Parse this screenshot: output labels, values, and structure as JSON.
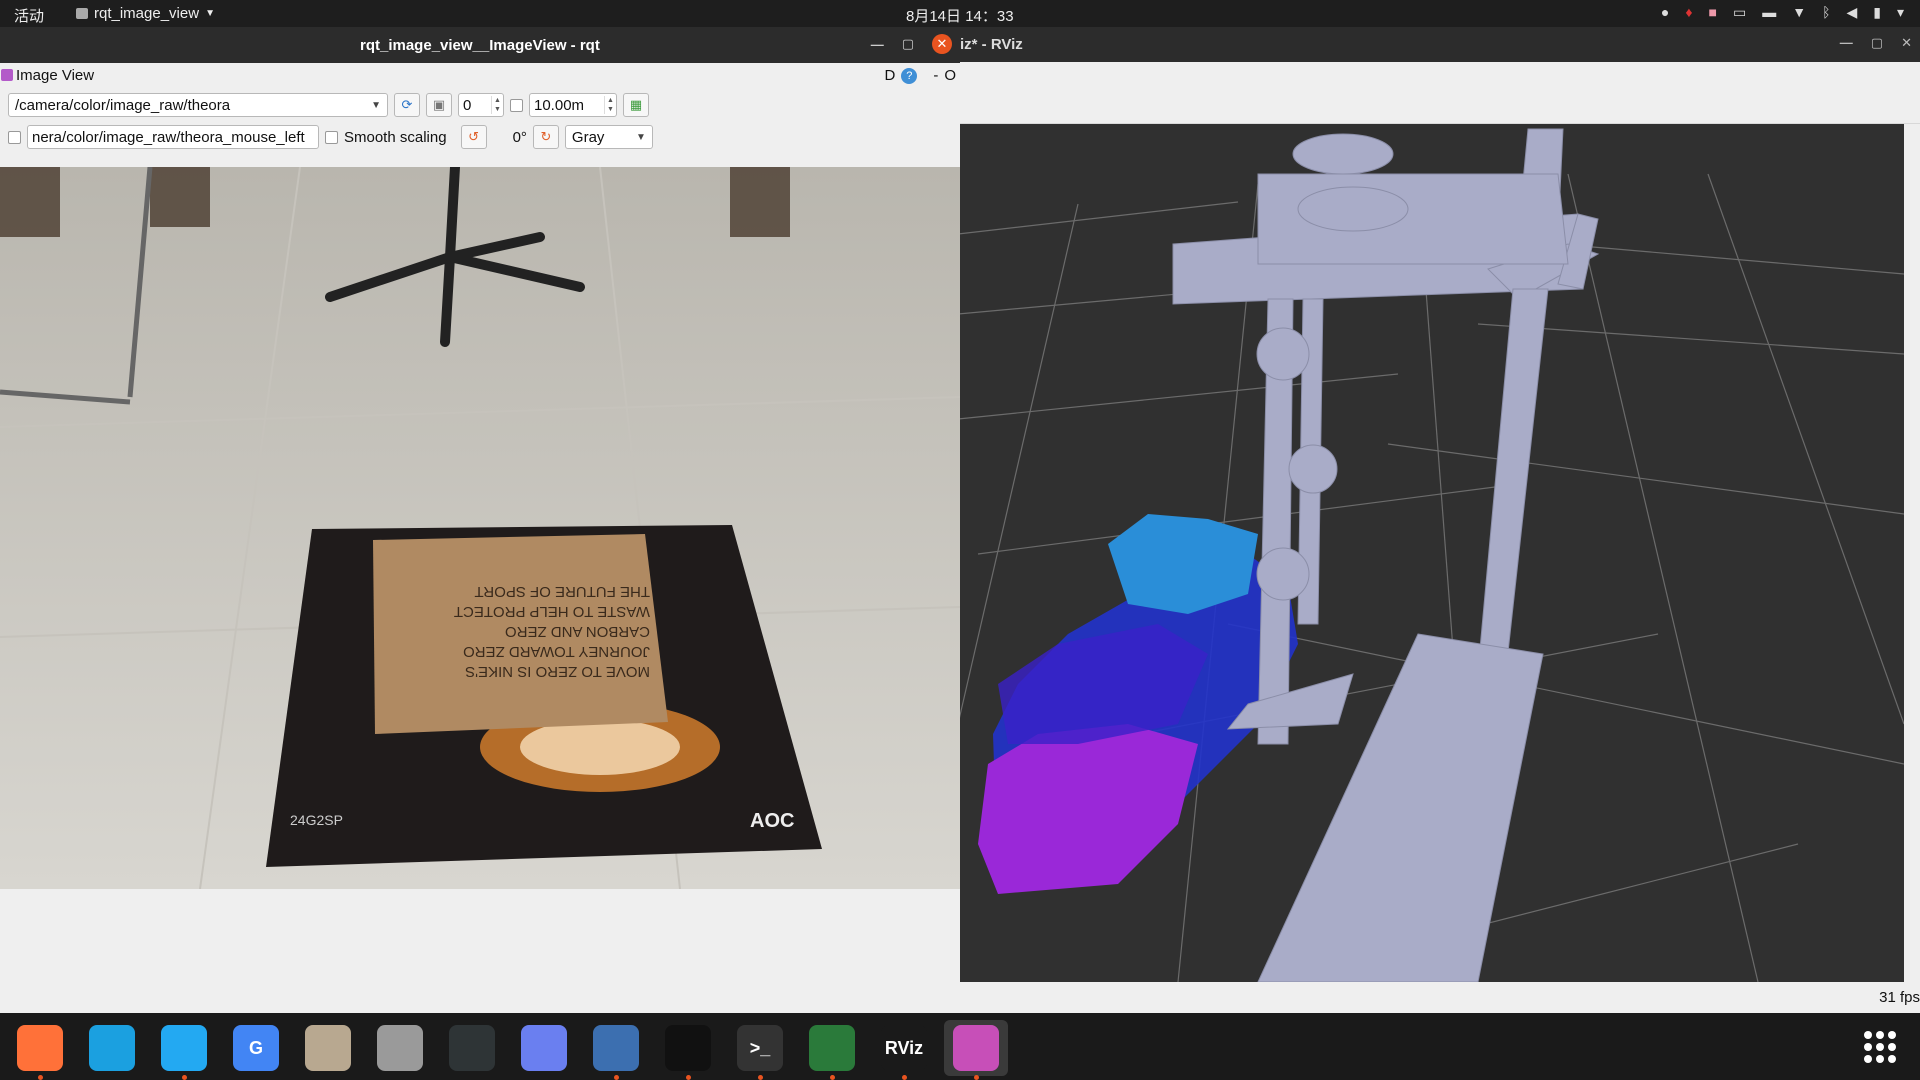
{
  "topbar": {
    "activities": "活动",
    "app_menu": "rqt_image_view",
    "clock": "8月14日  14：33"
  },
  "rviz": {
    "title": "iz* - RViz",
    "fps": "31 fps"
  },
  "rqt": {
    "title": "rqt_image_view__ImageView - rqt",
    "dock_title": "Image View",
    "dock_buttons": {
      "d": "D",
      "help": "?",
      "minus": "-",
      "o": "O"
    },
    "topic": "/camera/color/image_raw/theora",
    "spin_value": "0",
    "max_range": "10.00m",
    "mouse_topic": "nera/color/image_raw/theora_mouse_left",
    "smooth_scaling": "Smooth scaling",
    "rotation": "0°",
    "color_scheme": "Gray",
    "box_text": [
      "MOVE TO ZERO IS NIKE'S",
      "JOURNEY TOWARD ZERO",
      "CARBON AND ZERO",
      "WASTE TO HELP PROTECT",
      "THE FUTURE OF SPORT"
    ],
    "monitor_model": "24G2SP",
    "monitor_brand": "AOC"
  },
  "dock": {
    "apps": [
      {
        "name": "firefox",
        "label": "",
        "color": "#ff7139"
      },
      {
        "name": "edge",
        "label": "",
        "color": "#1ba0e0"
      },
      {
        "name": "vscode",
        "label": "",
        "color": "#23a9f2"
      },
      {
        "name": "translate",
        "label": "G",
        "color": "#4285f4"
      },
      {
        "name": "files",
        "label": "",
        "color": "#b8a890"
      },
      {
        "name": "settings",
        "label": "",
        "color": "#9a9a9a"
      },
      {
        "name": "system-monitor",
        "label": "",
        "color": "#2e3436"
      },
      {
        "name": "screenshot",
        "label": "",
        "color": "#6a7ff0"
      },
      {
        "name": "clash",
        "label": "",
        "color": "#3c6fb0"
      },
      {
        "name": "qq",
        "label": "",
        "color": "#111111"
      },
      {
        "name": "terminal",
        "label": ">_",
        "color": "#333333"
      },
      {
        "name": "camera",
        "label": "",
        "color": "#2a7a3a"
      },
      {
        "name": "rviz",
        "label": "RViz",
        "color": "#1a1a1a"
      },
      {
        "name": "image-viewer",
        "label": "",
        "color": "#c74fb8"
      }
    ]
  }
}
